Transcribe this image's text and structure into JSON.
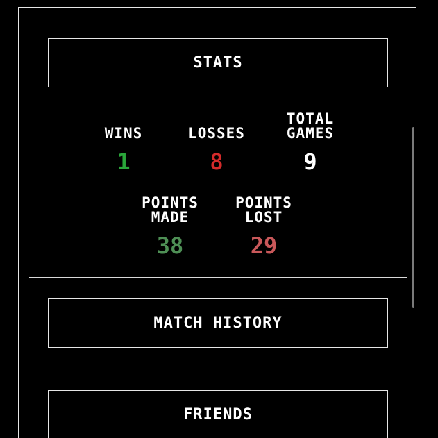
{
  "stats_section": {
    "button_label": "STATS",
    "wins": {
      "label": "WINS",
      "value": "1",
      "color": "#2aa63a"
    },
    "losses": {
      "label": "LOSSES",
      "value": "8",
      "color": "#d42b2b"
    },
    "total_games": {
      "label": "TOTAL\nGAMES",
      "value": "9",
      "color": "#ffffff"
    },
    "points_made": {
      "label": "POINTS\nMADE",
      "value": "38",
      "color": "#4e8f55"
    },
    "points_lost": {
      "label": "POINTS\nLOST",
      "value": "29",
      "color": "#c9585a"
    }
  },
  "match_history": {
    "button_label": "MATCH HISTORY"
  },
  "friends": {
    "button_label": "FRIENDS"
  }
}
